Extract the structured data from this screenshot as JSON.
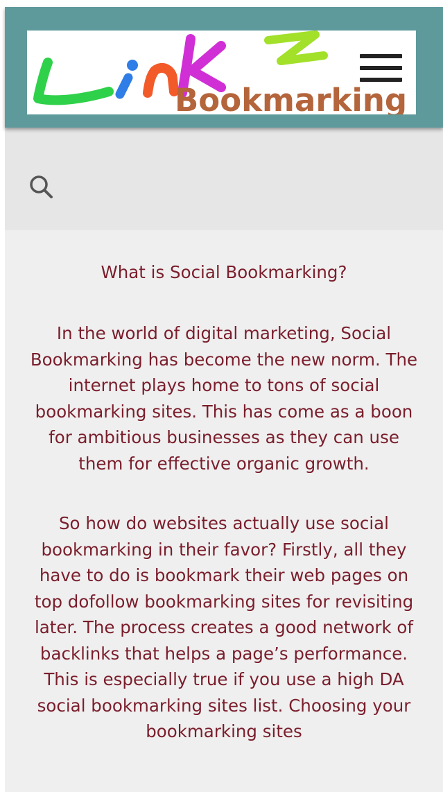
{
  "header": {
    "logo": {
      "brand_text": "Linkz",
      "tagline": "Bookmarking"
    },
    "menu_icon": "hamburger-menu-icon"
  },
  "search": {
    "icon": "search-icon"
  },
  "article": {
    "heading": "What is Social Bookmarking?",
    "paragraphs": [
      "In the world of digital marketing, Social Bookmarking has become the new norm. The internet plays home to tons of social bookmarking sites. This has come as a boon for ambitious businesses as they can use them for effective organic growth.",
      "So how do websites actually use social bookmarking in their favor? Firstly, all they have to do is bookmark their web pages on top dofollow bookmarking sites for revisiting later. The process creates a good network of backlinks that helps a page’s performance. This is especially true if you use a high DA social bookmarking sites list. Choosing your bookmarking sites"
    ]
  },
  "colors": {
    "header_bg": "#5e9a9c",
    "search_bg": "#e6e6e6",
    "content_bg": "#efefef",
    "text": "#7a1e2c",
    "logo_tagline": "#b4653b"
  }
}
